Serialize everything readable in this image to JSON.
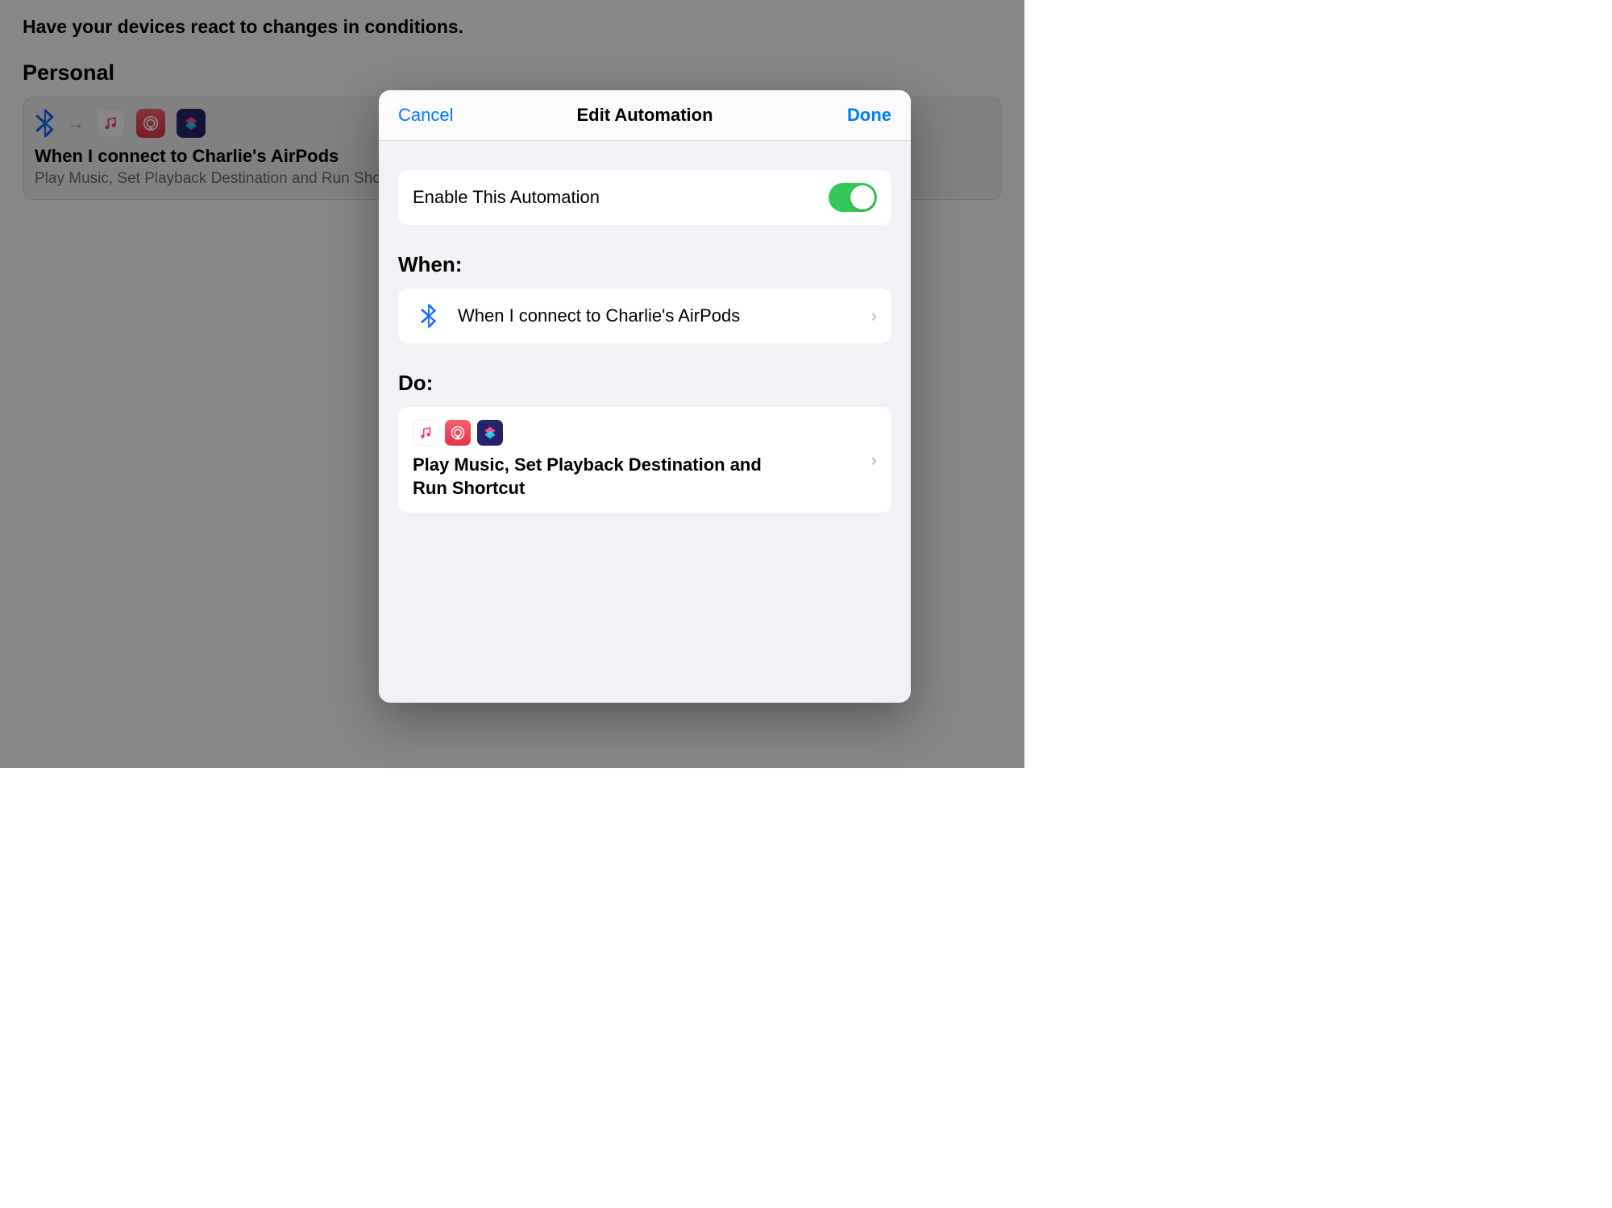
{
  "background": {
    "subtitle": "Have your devices react to changes in conditions.",
    "section_title": "Personal",
    "card": {
      "title": "When I connect to Charlie's AirPods",
      "subtitle": "Play Music, Set Playback Destination and Run Shor"
    }
  },
  "modal": {
    "cancel": "Cancel",
    "title": "Edit Automation",
    "done": "Done",
    "enable_row_label": "Enable This Automation",
    "enable_row_value": true,
    "when_label": "When:",
    "when_text": "When I connect to Charlie's AirPods",
    "do_label": "Do:",
    "do_text": "Play Music, Set Playback Destination and Run Shortcut"
  },
  "icons": {
    "bluetooth": "bluetooth-icon",
    "arrow": "→",
    "music": "music-icon",
    "airplay": "airplay-icon",
    "shortcuts": "shortcuts-icon",
    "chevron": "›"
  }
}
